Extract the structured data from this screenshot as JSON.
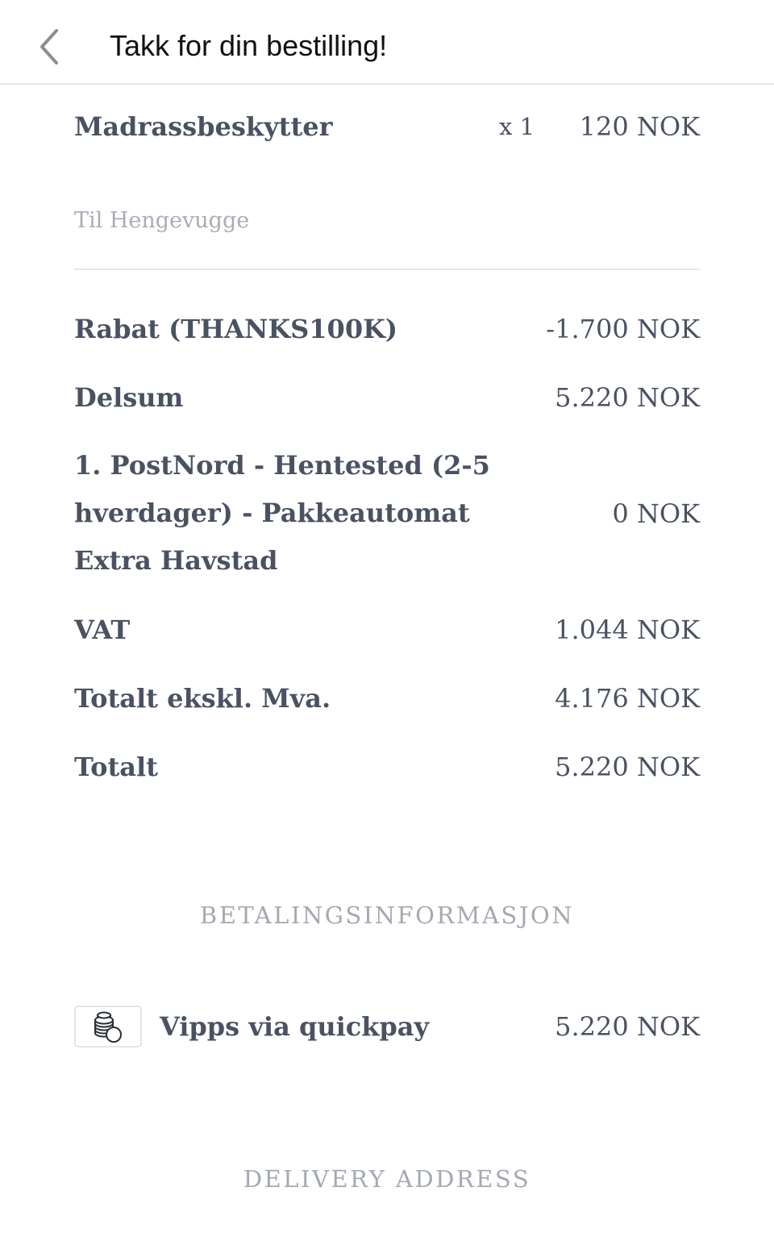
{
  "header": {
    "title": "Takk for din bestilling!"
  },
  "item": {
    "name": "Madrassbeskytter",
    "quantity": "x 1",
    "price": "120 NOK",
    "note": "Til Hengevugge"
  },
  "summary": {
    "discount_label": "Rabat (THANKS100K)",
    "discount_value": "-1.700 NOK",
    "subtotal_label": "Delsum",
    "subtotal_value": "5.220 NOK",
    "shipping_label": "1. PostNord - Hentested (2-5 hverdager) - Pakkeautomat Extra Havstad",
    "shipping_value": "0 NOK",
    "vat_label": "VAT",
    "vat_value": "1.044 NOK",
    "excl_label": "Totalt ekskl. Mva.",
    "excl_value": "4.176 NOK",
    "total_label": "Totalt",
    "total_value": "5.220 NOK"
  },
  "payment": {
    "section_title": "BETALINGSINFORMASJON",
    "icon": "coins-icon",
    "method": "Vipps via quickpay",
    "amount": "5.220 NOK"
  },
  "delivery": {
    "section_title": "DELIVERY ADDRESS"
  }
}
